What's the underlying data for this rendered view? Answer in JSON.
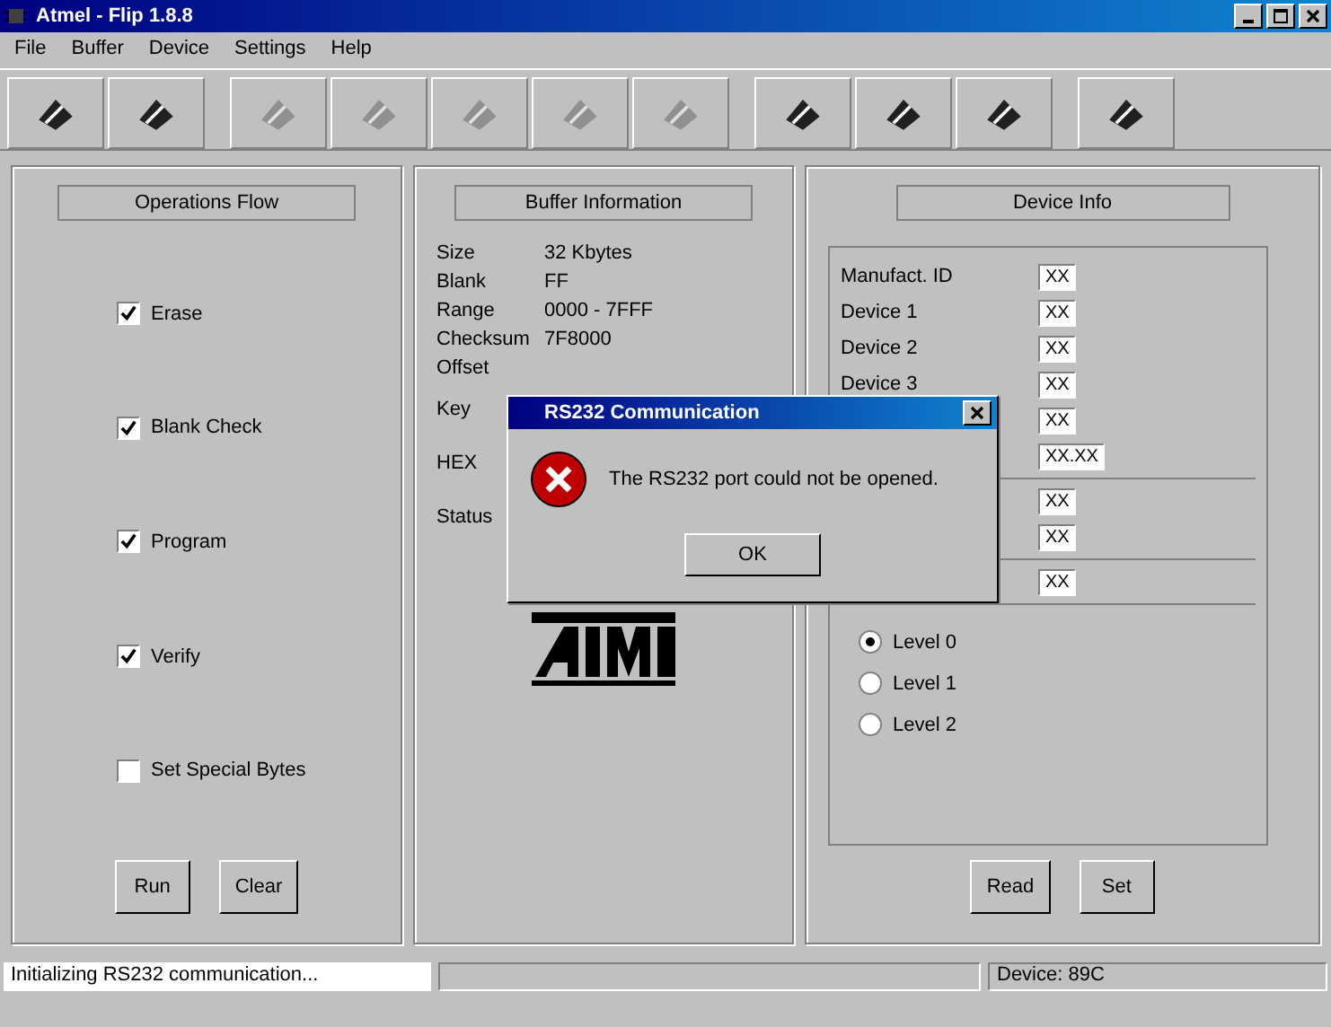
{
  "window": {
    "title": "Atmel - Flip 1.8.8"
  },
  "menu": [
    "File",
    "Buffer",
    "Device",
    "Settings",
    "Help"
  ],
  "toolbar": [
    {
      "disabled": false
    },
    {
      "disabled": false
    },
    {
      "disabled": true
    },
    {
      "disabled": true
    },
    {
      "disabled": true
    },
    {
      "disabled": true
    },
    {
      "disabled": true
    },
    {
      "disabled": false
    },
    {
      "disabled": false
    },
    {
      "disabled": false
    },
    {
      "disabled": false
    }
  ],
  "operations": {
    "title": "Operations Flow",
    "options": [
      {
        "label": "Erase",
        "checked": true
      },
      {
        "label": "Blank Check",
        "checked": true
      },
      {
        "label": "Program",
        "checked": true
      },
      {
        "label": "Verify",
        "checked": true
      },
      {
        "label": "Set Special Bytes",
        "checked": false
      }
    ],
    "buttons": [
      "Run",
      "Clear"
    ]
  },
  "buffer": {
    "title": "Buffer Information",
    "rows": [
      {
        "label": "Size",
        "value": "32 Kbytes"
      },
      {
        "label": "Blank",
        "value": "FF"
      },
      {
        "label": "Range",
        "value": "0000 - 7FFF"
      },
      {
        "label": "Checksum",
        "value": "7F8000"
      },
      {
        "label": "Offset",
        "value": ""
      },
      {
        "label": "Key",
        "value": ""
      },
      {
        "label": "HEX",
        "value": ""
      },
      {
        "label": "Status",
        "value": ""
      }
    ]
  },
  "device": {
    "title": "Device Info",
    "groups": [
      [
        {
          "label": "Manufact. ID",
          "value": "XX"
        },
        {
          "label": "Device 1",
          "value": "XX"
        },
        {
          "label": "Device 2",
          "value": "XX"
        },
        {
          "label": "Device 3",
          "value": "XX"
        },
        {
          "value": "XX"
        },
        {
          "value": "XX.XX"
        }
      ],
      [
        {
          "value": "XX"
        },
        {
          "value": "XX"
        }
      ],
      [
        {
          "value": "XX"
        }
      ]
    ],
    "levels": [
      {
        "label": "Level 0",
        "selected": true
      },
      {
        "label": "Level 1",
        "selected": false
      },
      {
        "label": "Level 2",
        "selected": false
      }
    ],
    "buttons": [
      "Read",
      "Set"
    ]
  },
  "dialog": {
    "title": "RS232 Communication",
    "message": "The RS232 port could not be opened.",
    "button": "OK"
  },
  "status_bar": {
    "message": "Initializing RS232 communication...",
    "device": "Device: 89C"
  }
}
